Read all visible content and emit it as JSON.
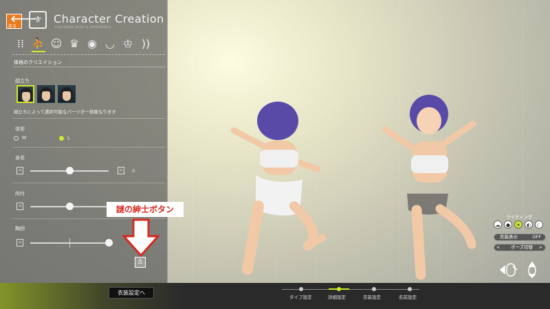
{
  "header": {
    "back_label": "戻る",
    "title": "Character Creation",
    "subtitle": "CUSTOMIZE BODY & APPEARANCE"
  },
  "icons": [
    "body-preset-icon",
    "body-shape-icon",
    "face-icon",
    "hair-icon",
    "eye-icon",
    "mouth-icon",
    "accessory-icon",
    "voice-icon"
  ],
  "section_title": "体格のクリエイション",
  "faces": {
    "label": "顔立ち",
    "note": "顔立ちによって選択可能なパーツが一部異なります",
    "selected_index": 0,
    "count": 3
  },
  "body_type": {
    "label": "体型",
    "options": [
      "M",
      "L"
    ],
    "selected": "L"
  },
  "sliders": [
    {
      "label": "身長",
      "value_text": "0",
      "level": 0.5
    },
    {
      "label": "肉付",
      "value_text": "",
      "level": 0.5
    },
    {
      "label": "胸囲",
      "value_text": "",
      "level": 1.0
    }
  ],
  "annotation": {
    "text": "謎の紳士ボタン",
    "color": "#d8281f"
  },
  "bottom": {
    "next_button": "衣装設定へ",
    "steps": [
      "タイプ設定",
      "詳細設定",
      "衣装設定",
      "名前設定"
    ],
    "active_step": "詳細設定"
  },
  "right_controls": {
    "lighting_label": "ライティング",
    "costume_label": "衣装表示",
    "costume_value": "OFF",
    "pose_label": "ポーズ切替"
  },
  "colors": {
    "accent": "#cdea2b",
    "back": "#e87a1d",
    "annotation": "#d8281f"
  }
}
